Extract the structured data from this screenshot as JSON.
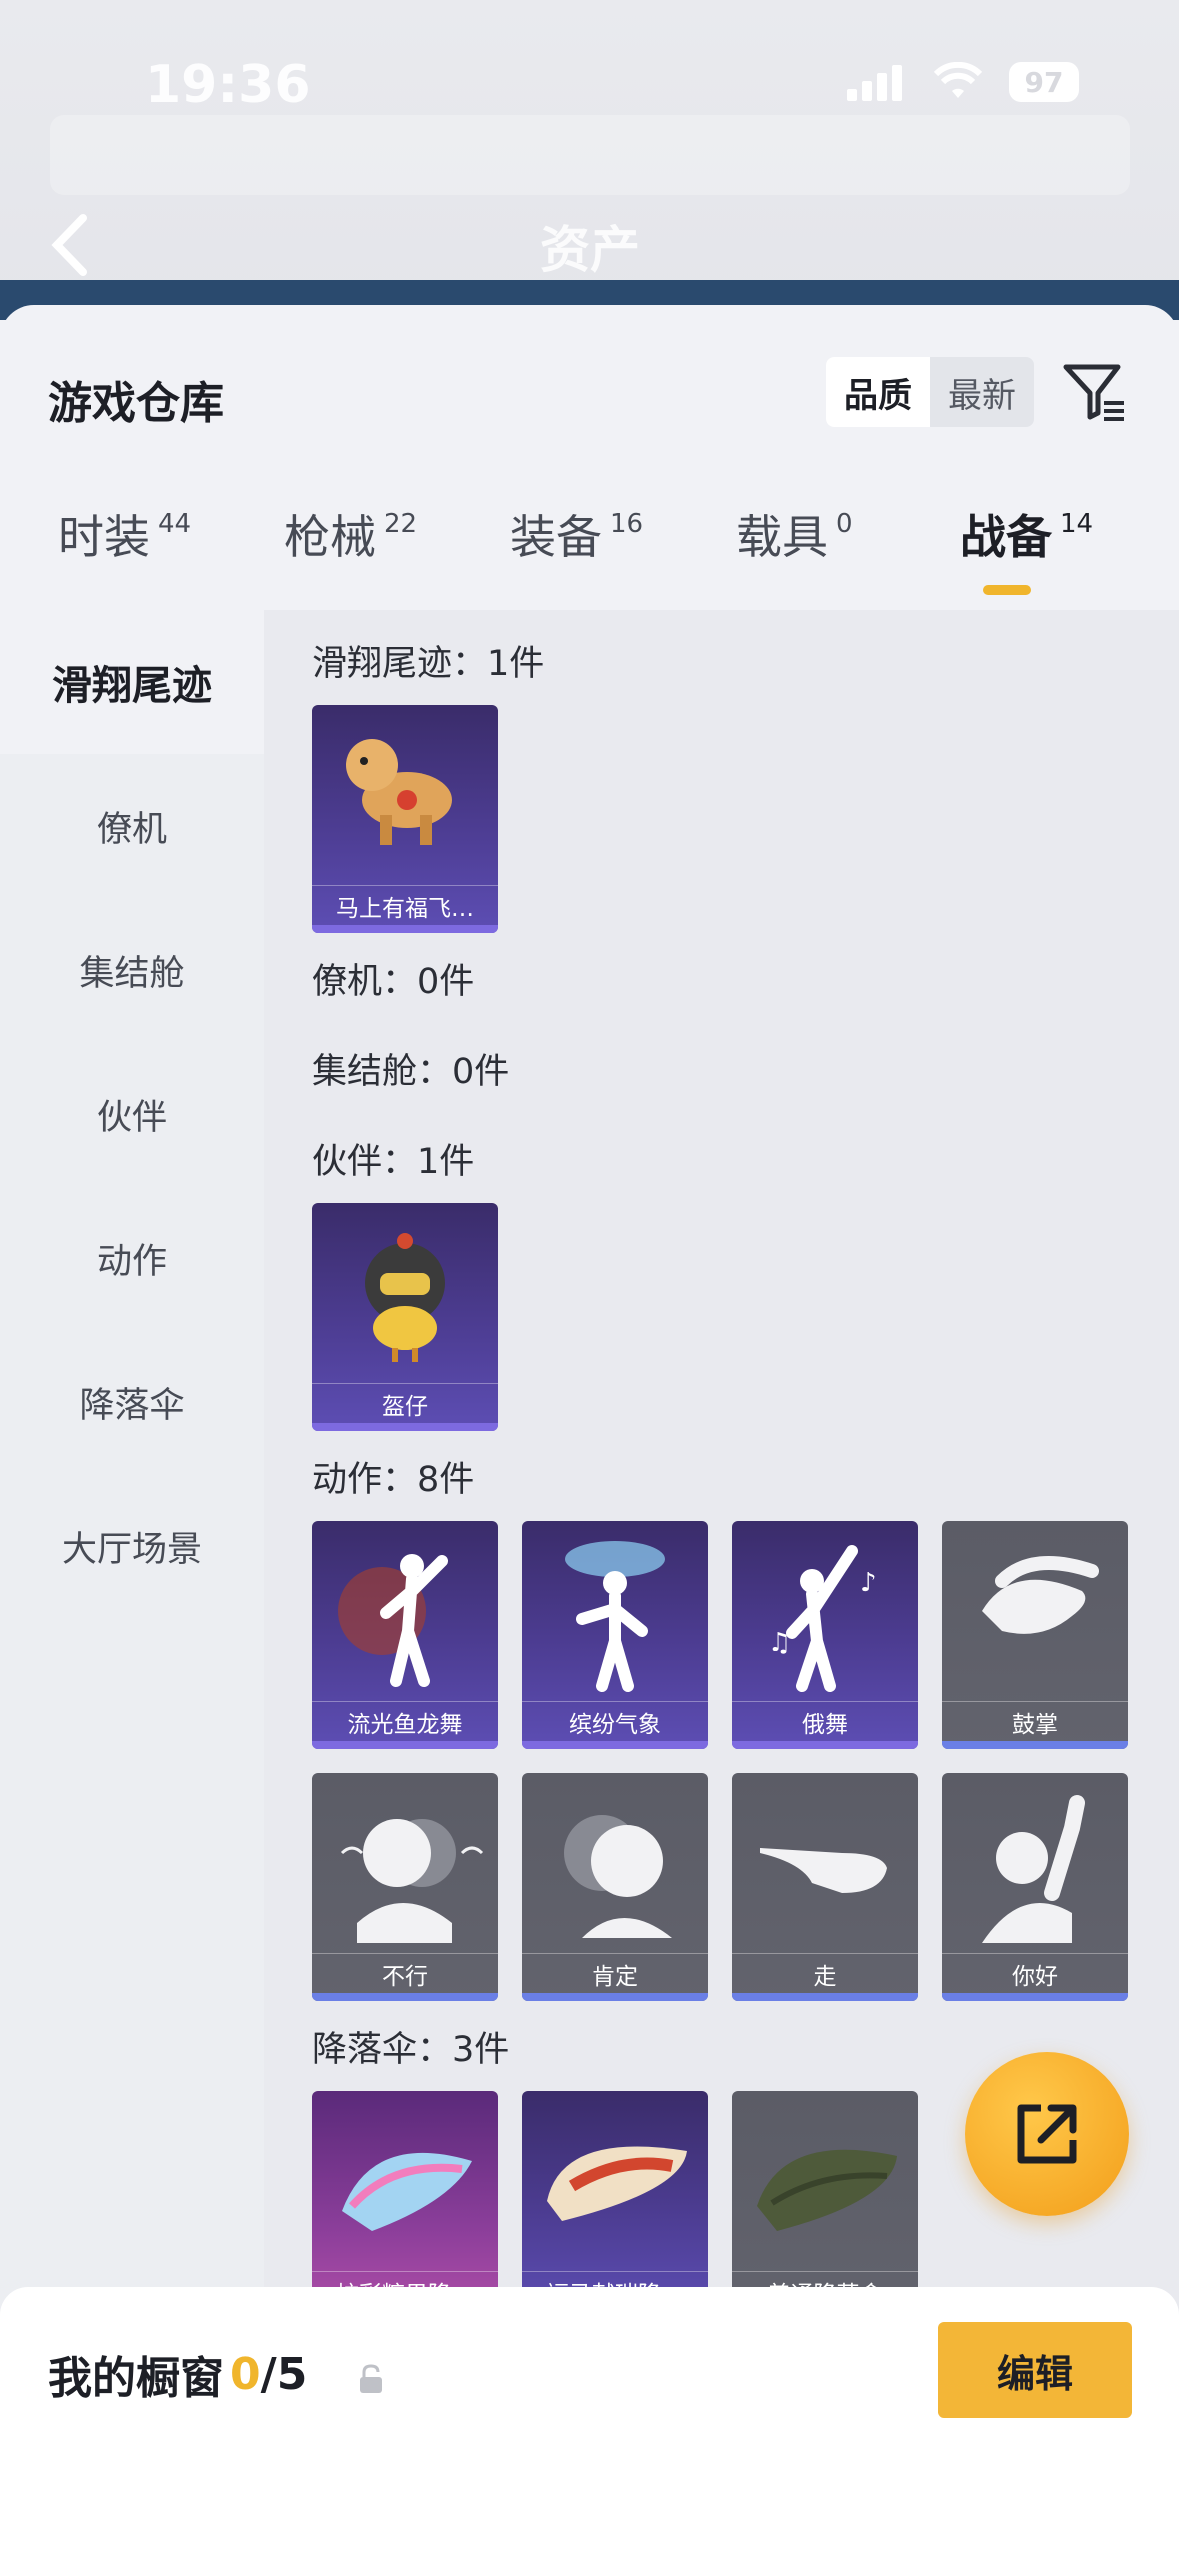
{
  "status_bar": {
    "time": "19:36",
    "battery": "97"
  },
  "nav": {
    "title": "资产"
  },
  "sheet": {
    "title": "游戏仓库",
    "sort_options": [
      "品质",
      "最新"
    ],
    "active_sort": "品质"
  },
  "tabs": [
    {
      "label": "时装",
      "count": "44"
    },
    {
      "label": "枪械",
      "count": "22"
    },
    {
      "label": "装备",
      "count": "16"
    },
    {
      "label": "载具",
      "count": "0"
    },
    {
      "label": "战备",
      "count": "14"
    }
  ],
  "categories": [
    "滑翔尾迹",
    "僚机",
    "集结舱",
    "伙伴",
    "动作",
    "降落伞",
    "大厅场景"
  ],
  "sections": {
    "glide": {
      "title": "滑翔尾迹：1件",
      "items": [
        "马上有福飞…"
      ]
    },
    "wingman": {
      "title": "僚机：0件"
    },
    "rally": {
      "title": "集结舱：0件"
    },
    "partner": {
      "title": "伙伴：1件",
      "items": [
        "盔仔"
      ]
    },
    "emote": {
      "title": "动作：8件",
      "items": [
        "流光鱼龙舞",
        "缤纷气象",
        "俄舞",
        "鼓掌",
        "不行",
        "肯定",
        "走",
        "你好"
      ]
    },
    "parachute": {
      "title": "降落伞：3件",
      "items": [
        "炫彩糖果降…",
        "福马献瑞降…",
        "普通降落伞"
      ]
    }
  },
  "bottom_bar": {
    "showcase_label": "我的橱窗",
    "showcase_current": "0",
    "showcase_total": "/5",
    "edit_label": "编辑"
  },
  "colors": {
    "accent": "#f0b52c",
    "purple_card": "#4d3d93",
    "gray_card": "#5b5c66"
  }
}
